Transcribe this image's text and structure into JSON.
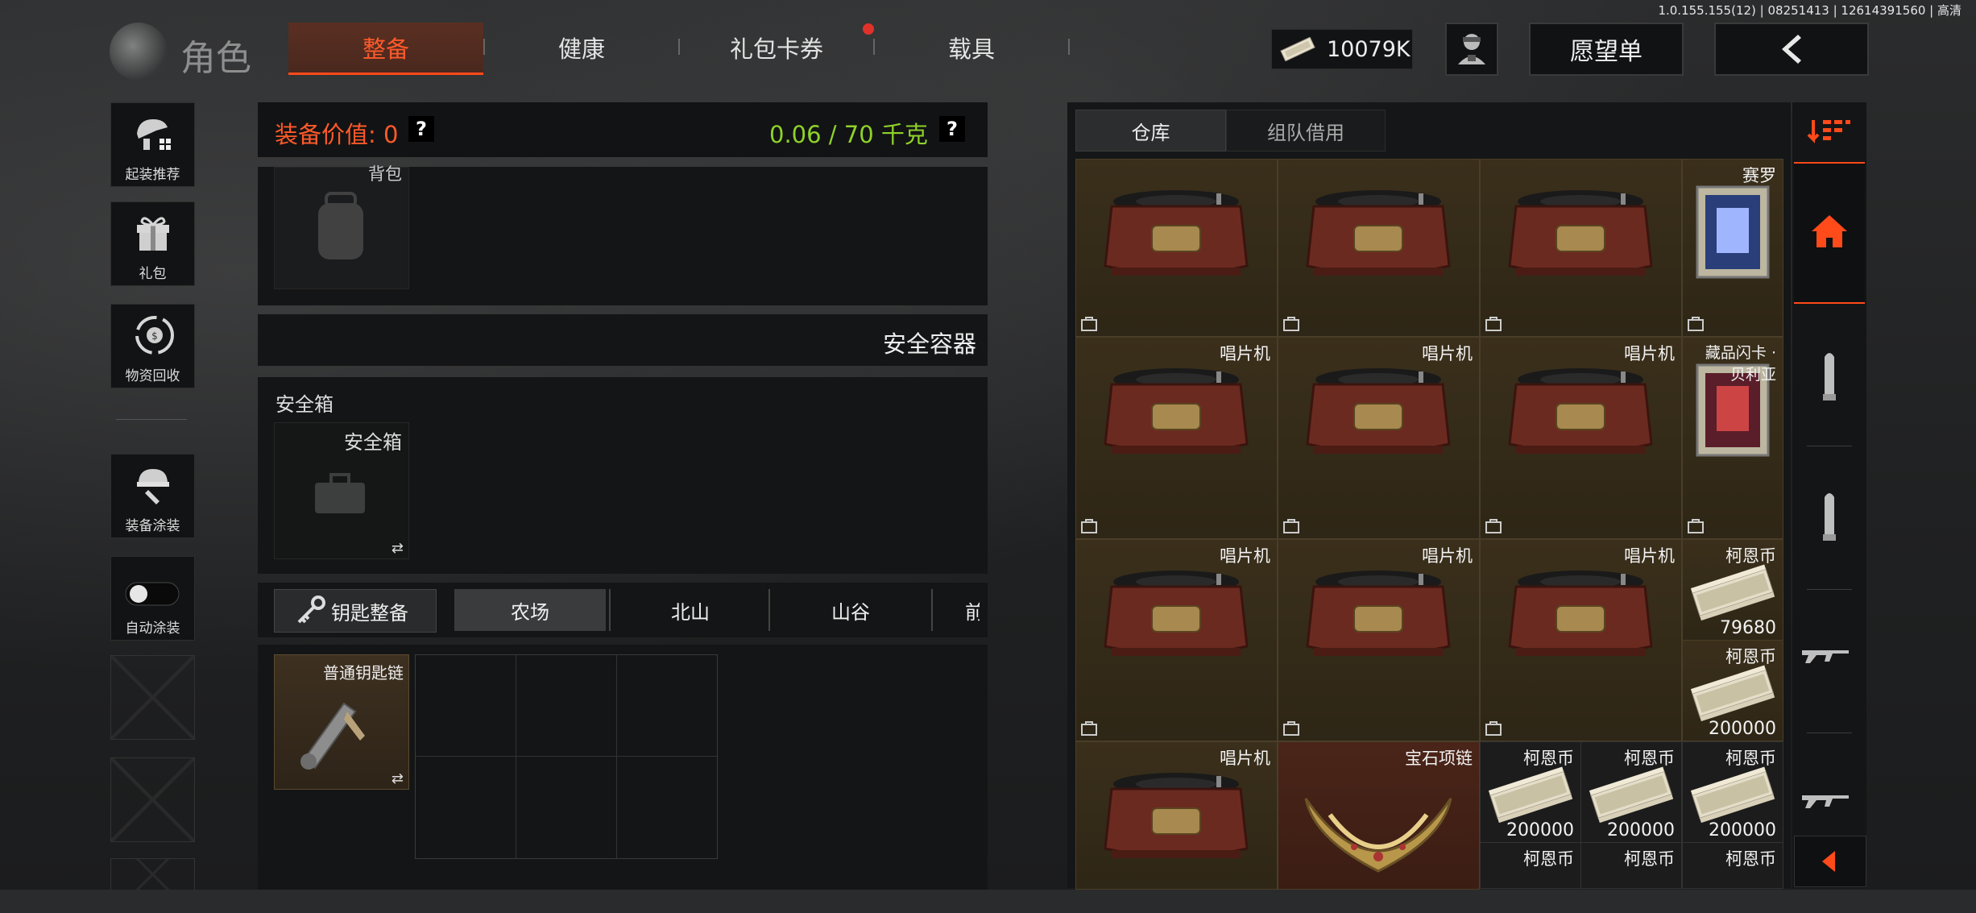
{
  "version": "1.0.155.155(12) | 08251413 | 12614391560 | 高清",
  "header": {
    "role_title": "角色",
    "tabs": [
      {
        "label": "整备",
        "active": true
      },
      {
        "label": "健康",
        "active": false
      },
      {
        "label": "礼包卡券",
        "active": false,
        "badge": true
      },
      {
        "label": "载具",
        "active": false
      }
    ],
    "currency": "10079K",
    "wishlist_label": "愿望单",
    "back_icon": "chevron-left-icon"
  },
  "sidebar": {
    "items": [
      {
        "label": "起装推荐",
        "icon": "loadout-recommend-icon"
      },
      {
        "label": "礼包",
        "icon": "gift-icon"
      },
      {
        "label": "物资回收",
        "icon": "recycle-icon"
      },
      {
        "label": "装备涂装",
        "icon": "paint-icon"
      },
      {
        "label": "自动涂装",
        "icon": "toggle-icon",
        "toggle_on": false
      }
    ]
  },
  "loadout": {
    "value_label": "装备价值: 0",
    "weight_label": "0.06 / 70 千克",
    "backpack_label": "背包",
    "secure_container_header": "安全容器",
    "secure_box_section": "安全箱",
    "secure_box_item": "安全箱",
    "key_button": "钥匙整备",
    "map_tabs": [
      "农场",
      "北山",
      "山谷",
      "前"
    ],
    "key_item": "普通钥匙链"
  },
  "warehouse": {
    "tabs": [
      {
        "label": "仓库",
        "active": true
      },
      {
        "label": "组队借用",
        "active": false
      }
    ],
    "labels": {
      "phonograph": "唱片机",
      "cairo": "赛罗",
      "card_belia": "藏品闪卡 · 贝利亚",
      "coin": "柯恩币",
      "necklace": "宝石项链"
    },
    "counts": [
      "79680",
      "200000",
      "200000",
      "200000",
      "200000"
    ]
  },
  "colors": {
    "accent": "#ff5a2a",
    "weight": "#8ed22a",
    "gold_cell": "#3a2f1b",
    "red_cell": "#4a2418"
  }
}
